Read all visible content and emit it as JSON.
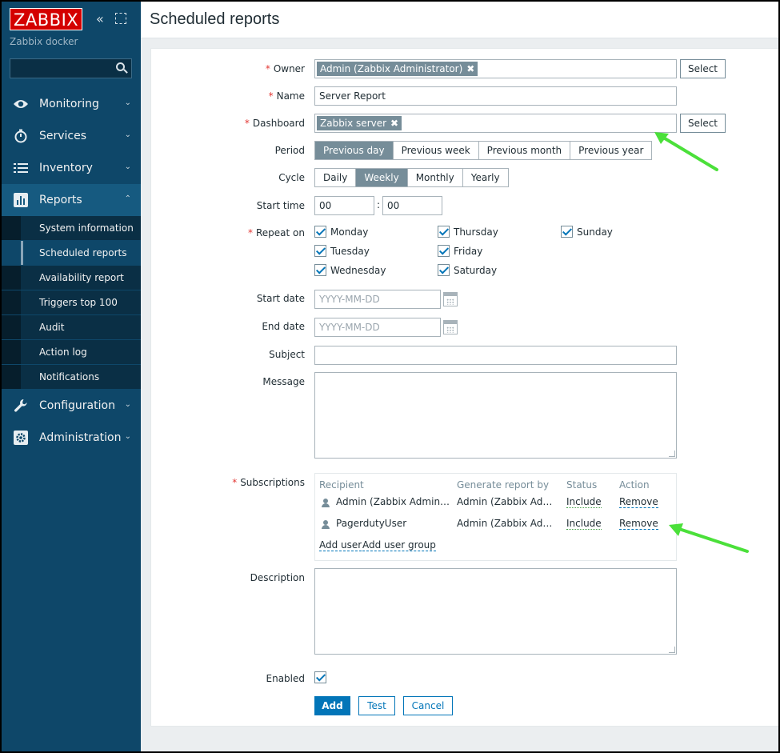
{
  "app": {
    "logo": "ZABBIX",
    "server_name": "Zabbix docker",
    "search_placeholder": ""
  },
  "sidebar": {
    "items": [
      {
        "label": "Monitoring",
        "icon": "eye-icon",
        "expanded": false
      },
      {
        "label": "Services",
        "icon": "stopwatch-icon",
        "expanded": false
      },
      {
        "label": "Inventory",
        "icon": "list-icon",
        "expanded": false
      },
      {
        "label": "Reports",
        "icon": "bar-chart-icon",
        "expanded": true
      },
      {
        "label": "Configuration",
        "icon": "wrench-icon",
        "expanded": false
      },
      {
        "label": "Administration",
        "icon": "gear-icon",
        "expanded": false
      }
    ],
    "reports_submenu": [
      "System information",
      "Scheduled reports",
      "Availability report",
      "Triggers top 100",
      "Audit",
      "Action log",
      "Notifications"
    ],
    "selected_submenu": "Scheduled reports"
  },
  "header": {
    "title": "Scheduled reports"
  },
  "form": {
    "owner": {
      "label": "Owner",
      "tag": "Admin (Zabbix Administrator)",
      "select": "Select"
    },
    "name": {
      "label": "Name",
      "value": "Server Report"
    },
    "dashboard": {
      "label": "Dashboard",
      "tag": "Zabbix server",
      "select": "Select"
    },
    "period": {
      "label": "Period",
      "options": [
        "Previous day",
        "Previous week",
        "Previous month",
        "Previous year"
      ],
      "selected": "Previous day"
    },
    "cycle": {
      "label": "Cycle",
      "options": [
        "Daily",
        "Weekly",
        "Monthly",
        "Yearly"
      ],
      "selected": "Weekly"
    },
    "start_time": {
      "label": "Start time",
      "hours": "00",
      "separator": ":",
      "minutes": "00"
    },
    "repeat_on": {
      "label": "Repeat on",
      "days": [
        "Monday",
        "Thursday",
        "Sunday",
        "Tuesday",
        "Friday",
        "Wednesday",
        "Saturday"
      ]
    },
    "start_date": {
      "label": "Start date",
      "placeholder": "YYYY-MM-DD"
    },
    "end_date": {
      "label": "End date",
      "placeholder": "YYYY-MM-DD"
    },
    "subject": {
      "label": "Subject",
      "value": ""
    },
    "message": {
      "label": "Message",
      "value": ""
    },
    "subscriptions": {
      "label": "Subscriptions",
      "columns": [
        "Recipient",
        "Generate report by",
        "Status",
        "Action"
      ],
      "rows": [
        {
          "recipient": "Admin (Zabbix Administrator)",
          "generate_by": "Admin (Zabbix Administrator)",
          "status": "Include",
          "action": "Remove"
        },
        {
          "recipient": "PagerdutyUser",
          "generate_by": "Admin (Zabbix Administrator)",
          "status": "Include",
          "action": "Remove"
        }
      ],
      "add_user": "Add user",
      "add_user_group": "Add user group"
    },
    "description": {
      "label": "Description",
      "value": ""
    },
    "enabled": {
      "label": "Enabled",
      "checked": true
    },
    "buttons": {
      "add": "Add",
      "test": "Test",
      "cancel": "Cancel"
    }
  },
  "colors": {
    "sidebar_bg": "#0e4769",
    "accent": "#0275b8",
    "logo_red": "#d40000",
    "annotation_arrow": "#4be03a"
  }
}
